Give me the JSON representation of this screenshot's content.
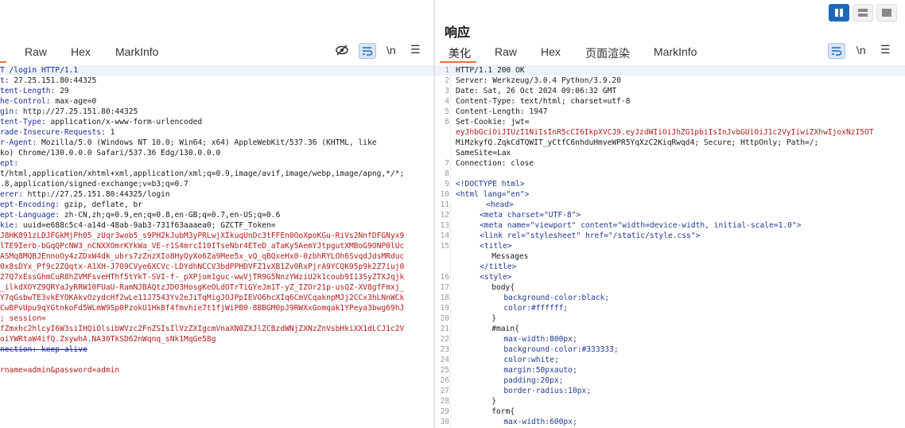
{
  "left": {
    "tabs": [
      "Raw",
      "Hex",
      "MarkInfo"
    ],
    "tools": {
      "eye": "hide-icon",
      "wrap": "wrap-icon",
      "newline": "\\n",
      "menu": "☰"
    },
    "lines": [
      {
        "key": "T /login HTTP/1.1",
        "val": "",
        "type": "start"
      },
      {
        "key": "t: ",
        "val": "27.25.151.80:44325"
      },
      {
        "key": "tent-Length: ",
        "val": "29"
      },
      {
        "key": "he-Control: ",
        "val": "max-age=0"
      },
      {
        "key": "gin: ",
        "val": "http://27.25.151.80:44325"
      },
      {
        "key": "tent-Type: ",
        "val": "application/x-www-form-urlencoded"
      },
      {
        "key": "rade-Insecure-Requests: ",
        "val": "1"
      },
      {
        "key": "r-Agent: ",
        "val": "Mozilla/5.0 (Windows NT 10.0; Win64; x64) AppleWebKit/537.36 (KHTML, like"
      },
      {
        "key": "",
        "val": "ko) Chrome/130.0.0.0 Safari/537.36 Edg/130.0.0.0"
      },
      {
        "key": "ept:",
        "val": ""
      },
      {
        "key": "",
        "val": "t/html,application/xhtml+xml,application/xml;q=0.9,image/avif,image/webp,image/apng,*/*;"
      },
      {
        "key": "",
        "val": ".8,application/signed-exchange;v=b3;q=0.7"
      },
      {
        "key": "erer: ",
        "val": "http://27.25.151.80:44325/login"
      },
      {
        "key": "ept-Encoding: ",
        "val": "gzip, deflate, br"
      },
      {
        "key": "ept-Language: ",
        "val": "zh-CN,zh;q=0.9,en;q=0.8,en-GB;q=0.7,en-US;q=0.6"
      },
      {
        "key": "kie: ",
        "val": "uuid=e688c5c4-a14d-48ab-9ab3-731f63aaaea0; GZCTF_Token=",
        "type": "cookie"
      },
      {
        "key": "",
        "val": "J8HK891zLDJFGkMjPh05_zUqr3wob5_s9PH2kJubM3yPRLwjXIkuqUnDc3tFFEn0OoXpoKGu-RiVs2NnfDFGNyx9",
        "type": "red"
      },
      {
        "key": "",
        "val": "lTE9Ierb-bGqQPcNW3_nCNXXOmrKYkWa_VE-r1S4mrcI10ITseNbr4ETeD_aTaKy5AemYJtpgutXMBoG9ONP0lUc",
        "type": "red"
      },
      {
        "key": "",
        "val": "ASMq8MQBJEnnoOy4zZDxW4dk_ubrs7zZnzXIo8HyQyXo6Za9Mee5x_vQ_qBQxeHx0-0zbhRYLOh6SvqdJdsMRduc",
        "type": "red"
      },
      {
        "key": "",
        "val": "0x8sDYx_Pf9c2ZQqtx-A1XH-J7O9CVye6XCVc-LDYdhNCCV3bdPPHDVFZ1vXB1Zv0RxPjrA9YCQK95p9k2Z7iuj0",
        "type": "red"
      },
      {
        "key": "",
        "val": "27Q7xEssGhmCuR8hZVMFsveHThf5tYkT-SVI-f-_pXPjom1guc-wwVjTR9G5NnzYWziU2k1coub9I13SyZTXJqjk",
        "type": "red"
      },
      {
        "key": "",
        "val": "_ilkdXOYZ9QRYaJyRRW10FUaU-RamNJBAQtzJDO3HosgKeOLdOTrTiGYeJm1T-yZ_IZOr21p-usQZ-XV8gfFmxj_",
        "type": "red"
      },
      {
        "key": "",
        "val": "Y7qGsbwTE3vkEYOKAkvOzydcHf2wLe11J7543Yv2eJiTqMigJOJPpIEVO6hcXIq6CmVCqaknpMJj2CCx3hLNnWCk",
        "type": "red"
      },
      {
        "key": "",
        "val": "CwBPvUpu9qYGtnkoFd5WLmW9Sp0PzokU1HkBf4fmvhie7t1fjWiPB0-8BBGM0pJ9RWXxGomqak1YPeya3bwg69hJ",
        "type": "red"
      },
      {
        "key": "",
        "val": "; session=",
        "type": "cookie2"
      },
      {
        "key": "",
        "val": "fZmxhc2hlcyI6W3siIHQiOlsibWVzc2FnZSIsIlVzZXIgcmVnaXN0ZXJlZCBzdWNjZXNzZnVsbHkiXX1dLCJ1c2V",
        "type": "red"
      },
      {
        "key": "",
        "val": "oiYWRtaW4ifQ.ZxywhA.NA30TkSD62nWqnq_sNk1MqGe58g",
        "type": "red"
      },
      {
        "key": "nection: ",
        "val": "keep-alive",
        "type": "strike"
      },
      {
        "key": "",
        "val": ""
      },
      {
        "key": "",
        "val": "rname=admin&password=admin",
        "type": "body"
      }
    ]
  },
  "right": {
    "title": "响应",
    "tabs": [
      "美化",
      "Raw",
      "Hex",
      "页面渲染",
      "MarkInfo"
    ],
    "tools": {
      "wrap": "wrap-icon",
      "newline": "\\n",
      "menu": "☰"
    },
    "view_buttons": [
      "split-vertical",
      "split-horizontal",
      "single"
    ],
    "lines": [
      {
        "n": "1",
        "text": "HTTP/1.1 200 OK"
      },
      {
        "n": "2",
        "text": "Server: Werkzeug/3.0.4 Python/3.9.20"
      },
      {
        "n": "3",
        "text": "Date: Sat, 26 Oct 2024 09:06:32 GMT"
      },
      {
        "n": "4",
        "text": "Content-Type: text/html; charset=utf-8"
      },
      {
        "n": "5",
        "text": "Content-Length: 1947"
      },
      {
        "n": "6",
        "text": "Set-Cookie: jwt="
      },
      {
        "n": "",
        "text": "eyJhbGciOiJIUzI1NiIsInR5cCI6IkpXVCJ9.eyJzdWIiOiJhZG1pbiIsInJvbGUiOiJ1c2VyIiwiZXhwIjoxNzI5OT",
        "type": "red"
      },
      {
        "n": "",
        "text": "MiMzkyfQ.ZqkCdTQWIT_yCtfC6nhduHmveWPR5YqXzC2KiqRwqd4; Secure; HttpOnly; Path=/;",
        "type": "cookieend"
      },
      {
        "n": "",
        "text": "SameSite=Lax"
      },
      {
        "n": "7",
        "text": "Connection: close"
      },
      {
        "n": "8",
        "text": ""
      },
      {
        "n": "9",
        "text": "<!DOCTYPE html>",
        "type": "doctype"
      },
      {
        "n": "10",
        "text": "<html lang=\"en\">",
        "type": "html"
      },
      {
        "n": "11",
        "text": "    <head>",
        "type": "tag",
        "indent": 2
      },
      {
        "n": "12",
        "text": "<meta charset=\"UTF-8\">",
        "type": "html",
        "indent": 4
      },
      {
        "n": "13",
        "text": "<meta name=\"viewport\" content=\"width=device-width, initial-scale=1.0\">",
        "type": "html",
        "indent": 4
      },
      {
        "n": "14",
        "text": "<link rel=\"stylesheet\" href=\"/static/style.css\">",
        "type": "html",
        "indent": 4
      },
      {
        "n": "15",
        "text": "<title>",
        "type": "tag",
        "indent": 4
      },
      {
        "n": "",
        "text": "Messages",
        "type": "plain",
        "indent": 6
      },
      {
        "n": "",
        "text": "</title>",
        "type": "tag",
        "indent": 4
      },
      {
        "n": "16",
        "text": "<style>",
        "type": "tag",
        "indent": 4
      },
      {
        "n": "17",
        "text": "body{",
        "type": "plain",
        "indent": 6
      },
      {
        "n": "18",
        "text": "background-color:black;",
        "type": "css",
        "indent": 8
      },
      {
        "n": "19",
        "text": "color:#ffffff;",
        "type": "css",
        "indent": 8
      },
      {
        "n": "20",
        "text": "}",
        "type": "plain",
        "indent": 6
      },
      {
        "n": "21",
        "text": "#main{",
        "type": "plain",
        "indent": 6
      },
      {
        "n": "22",
        "text": "max-width:800px;",
        "type": "css",
        "indent": 8
      },
      {
        "n": "23",
        "text": "background-color:#333333;",
        "type": "css",
        "indent": 8
      },
      {
        "n": "24",
        "text": "color:white;",
        "type": "css",
        "indent": 8
      },
      {
        "n": "25",
        "text": "margin:50pxauto;",
        "type": "css",
        "indent": 8
      },
      {
        "n": "26",
        "text": "padding:20px;",
        "type": "css",
        "indent": 8
      },
      {
        "n": "27",
        "text": "border-radius:10px;",
        "type": "css",
        "indent": 8
      },
      {
        "n": "28",
        "text": "}",
        "type": "plain",
        "indent": 6
      },
      {
        "n": "29",
        "text": "form{",
        "type": "plain",
        "indent": 6
      },
      {
        "n": "30",
        "text": "max-width:600px;",
        "type": "css",
        "indent": 8
      }
    ]
  }
}
